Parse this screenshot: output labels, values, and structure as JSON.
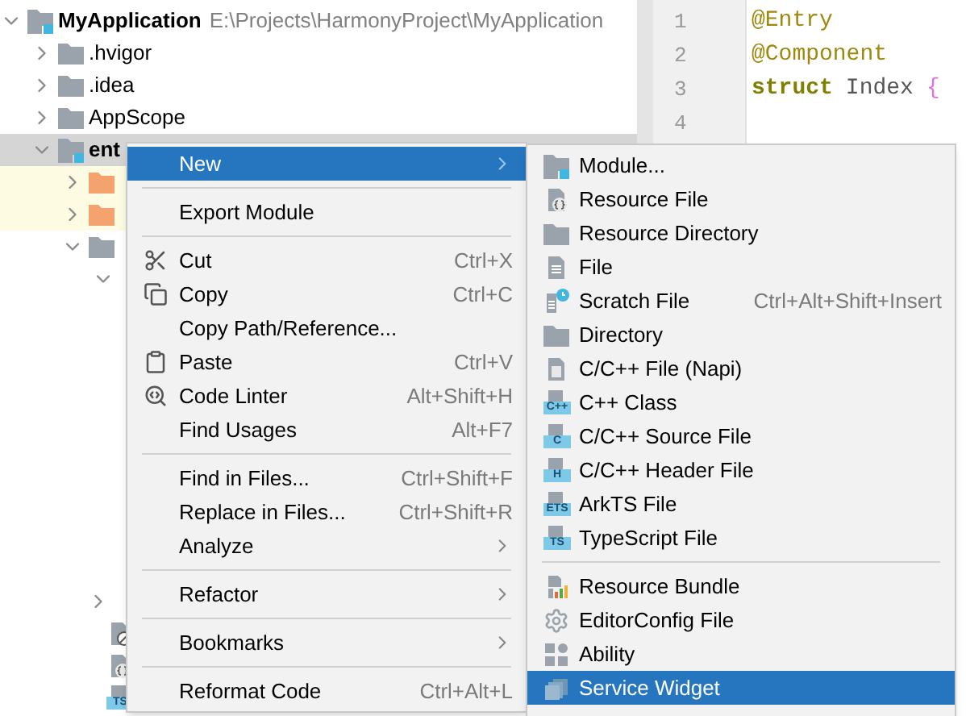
{
  "project_tree": {
    "label": "MyApplication",
    "path": "E:\\Projects\\HarmonyProject\\MyApplication",
    "kind": "module",
    "expanded": true,
    "selected": false,
    "highlighted": false,
    "children": [
      {
        "label": ".hvigor",
        "kind": "folder",
        "expanded": false,
        "selected": false,
        "highlighted": false
      },
      {
        "label": ".idea",
        "kind": "folder",
        "expanded": false,
        "selected": false,
        "highlighted": false
      },
      {
        "label": "AppScope",
        "kind": "folder",
        "expanded": false,
        "selected": false,
        "highlighted": false
      },
      {
        "label": "ent",
        "kind": "module",
        "expanded": true,
        "selected": true,
        "highlighted": false,
        "children": [
          {
            "kind": "excluded",
            "expanded": false,
            "selected": false,
            "highlighted": true
          },
          {
            "kind": "excluded",
            "expanded": false,
            "selected": false,
            "highlighted": true
          },
          {
            "kind": "folder",
            "expanded": true,
            "selected": false,
            "highlighted": false,
            "children": [
              {
                "expanded": true,
                "selected": false,
                "highlighted": false
              }
            ]
          }
        ]
      }
    ]
  },
  "tree_bottom_rows": [
    {
      "kind": "folder",
      "expanded": false
    },
    {
      "kind": "config"
    },
    {
      "kind": "resource"
    },
    {
      "kind": "typed",
      "badge": "TS"
    }
  ],
  "editor": {
    "lines": [
      {
        "number": "1",
        "kind": "annotation",
        "code": "@Entry"
      },
      {
        "number": "2",
        "kind": "annotation",
        "code": "@Component"
      },
      {
        "number": "3",
        "kind": "struct",
        "keyword": "struct",
        "name": "Index",
        "brace": "{"
      },
      {
        "number": "4",
        "kind": "empty"
      }
    ]
  },
  "context_menu": [
    {
      "kind": "item",
      "label": "New",
      "selected": true,
      "submenu": true
    },
    {
      "kind": "separator"
    },
    {
      "kind": "item",
      "label": "Export Module",
      "selected": false
    },
    {
      "kind": "separator"
    },
    {
      "kind": "item",
      "label": "Cut",
      "shortcut": "Ctrl+X",
      "selected": false
    },
    {
      "kind": "item",
      "label": "Copy",
      "shortcut": "Ctrl+C",
      "selected": false
    },
    {
      "kind": "item",
      "label": "Copy Path/Reference...",
      "selected": false
    },
    {
      "kind": "item",
      "label": "Paste",
      "shortcut": "Ctrl+V",
      "selected": false
    },
    {
      "kind": "item",
      "label": "Code Linter",
      "shortcut": "Alt+Shift+H",
      "selected": false
    },
    {
      "kind": "item",
      "label": "Find Usages",
      "shortcut": "Alt+F7",
      "selected": false
    },
    {
      "kind": "separator"
    },
    {
      "kind": "item",
      "label": "Find in Files...",
      "shortcut": "Ctrl+Shift+F",
      "selected": false
    },
    {
      "kind": "item",
      "label": "Replace in Files...",
      "shortcut": "Ctrl+Shift+R",
      "selected": false
    },
    {
      "kind": "item",
      "label": "Analyze",
      "submenu": true,
      "selected": false
    },
    {
      "kind": "separator"
    },
    {
      "kind": "item",
      "label": "Refactor",
      "submenu": true,
      "selected": false
    },
    {
      "kind": "separator"
    },
    {
      "kind": "item",
      "label": "Bookmarks",
      "submenu": true,
      "selected": false
    },
    {
      "kind": "separator"
    },
    {
      "kind": "item",
      "label": "Reformat Code",
      "shortcut": "Ctrl+Alt+L",
      "selected": false
    }
  ],
  "new_submenu": [
    {
      "kind": "item",
      "label": "Module...",
      "selected": false
    },
    {
      "kind": "item",
      "label": "Resource File",
      "selected": false
    },
    {
      "kind": "item",
      "label": "Resource Directory",
      "selected": false
    },
    {
      "kind": "item",
      "label": "File",
      "selected": false
    },
    {
      "kind": "item",
      "label": "Scratch File",
      "shortcut": "Ctrl+Alt+Shift+Insert",
      "selected": false
    },
    {
      "kind": "item",
      "label": "Directory",
      "selected": false
    },
    {
      "kind": "item",
      "label": "C/C++ File (Napi)",
      "selected": false
    },
    {
      "kind": "item",
      "label": "C++ Class",
      "badge": "C++",
      "selected": false
    },
    {
      "kind": "item",
      "label": "C/C++ Source File",
      "badge": "C",
      "selected": false
    },
    {
      "kind": "item",
      "label": "C/C++ Header File",
      "badge": "H",
      "selected": false
    },
    {
      "kind": "item",
      "label": "ArkTS File",
      "badge": "ETS",
      "selected": false
    },
    {
      "kind": "item",
      "label": "TypeScript File",
      "badge": "TS",
      "selected": false
    },
    {
      "kind": "separator"
    },
    {
      "kind": "item",
      "label": "Resource Bundle",
      "selected": false
    },
    {
      "kind": "item",
      "label": "EditorConfig File",
      "selected": false
    },
    {
      "kind": "item",
      "label": "Ability",
      "selected": false
    },
    {
      "kind": "item",
      "label": "Service Widget",
      "selected": true
    }
  ]
}
